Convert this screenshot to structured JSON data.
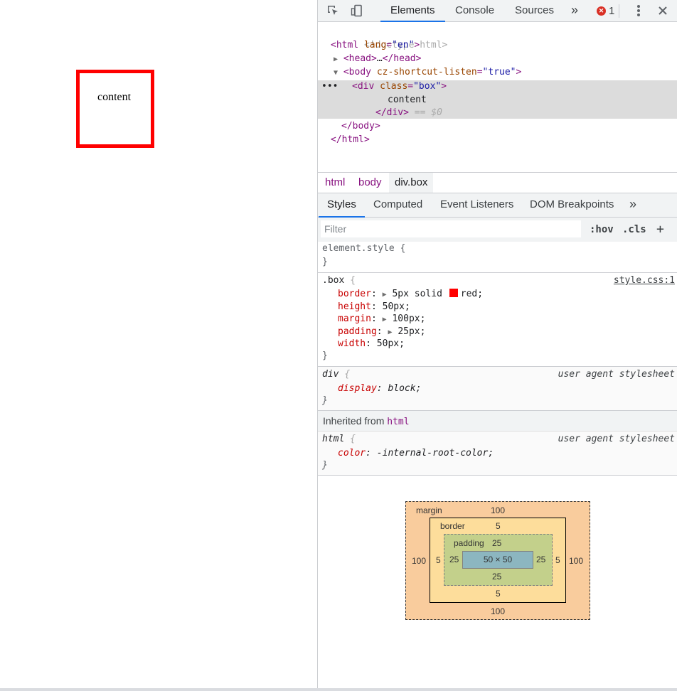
{
  "page": {
    "box_text": "content"
  },
  "toolbar": {
    "tabs": [
      "Elements",
      "Console",
      "Sources"
    ],
    "more": "»",
    "error_count": "1",
    "error_glyph": "✕"
  },
  "dom": {
    "doctype": "<!doctype html>",
    "html_open_tag": "<html",
    "html_lang_attr": "lang",
    "html_lang_val": "\"en\"",
    "head_open": "<head>",
    "ellipsis": "…",
    "head_close": "</head>",
    "body_open": "<body",
    "body_attr": "cz-shortcut-listen",
    "body_val": "\"true\"",
    "div_open": "<div",
    "div_attr": "class",
    "div_val": "\"box\"",
    "div_text": "content",
    "div_close": "</div>",
    "eq0": " == $0",
    "body_close": "</body>",
    "html_close": "</html>",
    "row_dots": "•••"
  },
  "breadcrumbs": [
    "html",
    "body",
    "div.box"
  ],
  "styles_tabs": [
    "Styles",
    "Computed",
    "Event Listeners",
    "DOM Breakpoints"
  ],
  "styles_more": "»",
  "filter": {
    "placeholder": "Filter",
    "hov": ":hov",
    "cls": ".cls",
    "plus": "+"
  },
  "rules": {
    "element_style": {
      "selector": "element.style {",
      "close": "}"
    },
    "box": {
      "selector": ".box",
      "source": "style.css:1",
      "decls": [
        {
          "prop": "border",
          "value": "5px solid ",
          "extra": "red;",
          "expandable": true
        },
        {
          "prop": "height",
          "value": "50px;"
        },
        {
          "prop": "margin",
          "value": "100px;",
          "expandable": true
        },
        {
          "prop": "padding",
          "value": "25px;",
          "expandable": true
        },
        {
          "prop": "width",
          "value": "50px;"
        }
      ]
    },
    "div": {
      "selector": "div",
      "source": "user agent stylesheet",
      "prop": "display",
      "value": "block;"
    },
    "inherited_label": "Inherited from",
    "inherited_tag": "html",
    "html": {
      "selector": "html",
      "source": "user agent stylesheet",
      "prop": "color",
      "value": "-internal-root-color;"
    }
  },
  "box_model": {
    "margin_label": "margin",
    "border_label": "border",
    "padding_label": "padding",
    "margin": {
      "top": "100",
      "right": "100",
      "bottom": "100",
      "left": "100"
    },
    "border": {
      "top": "5",
      "right": "5",
      "bottom": "5",
      "left": "5"
    },
    "padding": {
      "top": "25",
      "right": "25",
      "bottom": "25",
      "left": "25"
    },
    "content": "50 × 50"
  },
  "colors": {
    "accent": "#1a73e8",
    "box_border": "#ff0000"
  }
}
